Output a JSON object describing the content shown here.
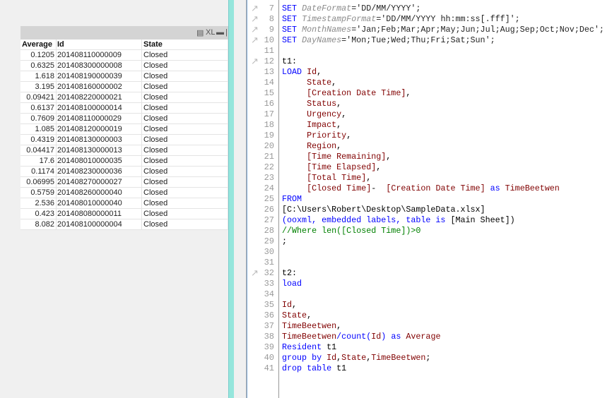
{
  "table": {
    "caption_icons": [
      "print-icon",
      "xl-export-icon",
      "minimize-icon",
      "restore-icon"
    ],
    "caption_xl": "XL",
    "columns": [
      "Average",
      "Id",
      "State"
    ],
    "rows": [
      [
        "0.1205",
        "201408110000009",
        "Closed"
      ],
      [
        "0.6325",
        "201408300000008",
        "Closed"
      ],
      [
        "1.618",
        "201408190000039",
        "Closed"
      ],
      [
        "3.195",
        "201408160000002",
        "Closed"
      ],
      [
        "0.09421",
        "201408220000021",
        "Closed"
      ],
      [
        "0.6137",
        "201408100000014",
        "Closed"
      ],
      [
        "0.7609",
        "201408110000029",
        "Closed"
      ],
      [
        "1.085",
        "201408120000019",
        "Closed"
      ],
      [
        "0.4319",
        "201408130000003",
        "Closed"
      ],
      [
        "0.04417",
        "201408130000013",
        "Closed"
      ],
      [
        "17.6",
        "201408010000035",
        "Closed"
      ],
      [
        "0.1174",
        "201408230000036",
        "Closed"
      ],
      [
        "0.06995",
        "201408270000027",
        "Closed"
      ],
      [
        "0.5759",
        "201408260000040",
        "Closed"
      ],
      [
        "2.536",
        "201408010000040",
        "Closed"
      ],
      [
        "0.423",
        "201408080000011",
        "Closed"
      ],
      [
        "8.082",
        "201408100000004",
        "Closed"
      ]
    ]
  },
  "editor": {
    "colors": {
      "keyword": "#0000ff",
      "variable": "#8a8a8a",
      "field": "#800000",
      "comment": "#008000"
    },
    "lines": [
      {
        "n": "7",
        "mark": true,
        "seg": [
          [
            "k",
            "SET "
          ],
          [
            "v",
            "DateFormat"
          ],
          [
            "s",
            "='DD/MM/YYYY';"
          ]
        ]
      },
      {
        "n": "8",
        "mark": true,
        "seg": [
          [
            "k",
            "SET "
          ],
          [
            "v",
            "TimestampFormat"
          ],
          [
            "s",
            "='DD/MM/YYYY hh:mm:ss[.fff]';"
          ]
        ]
      },
      {
        "n": "9",
        "mark": true,
        "seg": [
          [
            "k",
            "SET "
          ],
          [
            "v",
            "MonthNames"
          ],
          [
            "s",
            "='Jan;Feb;Mar;Apr;May;Jun;Jul;Aug;Sep;Oct;Nov;Dec';"
          ]
        ]
      },
      {
        "n": "10",
        "mark": true,
        "seg": [
          [
            "k",
            "SET "
          ],
          [
            "v",
            "DayNames"
          ],
          [
            "s",
            "='Mon;Tue;Wed;Thu;Fri;Sat;Sun';"
          ]
        ]
      },
      {
        "n": "11",
        "seg": []
      },
      {
        "n": "12",
        "mark": true,
        "seg": [
          [
            "p",
            "t1:"
          ]
        ]
      },
      {
        "n": "13",
        "seg": [
          [
            "k",
            "LOAD "
          ],
          [
            "f",
            "Id"
          ],
          [
            "p",
            ","
          ]
        ]
      },
      {
        "n": "14",
        "seg": [
          [
            "p",
            "     "
          ],
          [
            "f",
            "State"
          ],
          [
            "p",
            ","
          ]
        ]
      },
      {
        "n": "15",
        "seg": [
          [
            "p",
            "     "
          ],
          [
            "f",
            "[Creation Date Time]"
          ],
          [
            "p",
            ","
          ]
        ]
      },
      {
        "n": "16",
        "seg": [
          [
            "p",
            "     "
          ],
          [
            "f",
            "Status"
          ],
          [
            "p",
            ","
          ]
        ]
      },
      {
        "n": "17",
        "seg": [
          [
            "p",
            "     "
          ],
          [
            "f",
            "Urgency"
          ],
          [
            "p",
            ","
          ]
        ]
      },
      {
        "n": "18",
        "seg": [
          [
            "p",
            "     "
          ],
          [
            "f",
            "Impact"
          ],
          [
            "p",
            ","
          ]
        ]
      },
      {
        "n": "19",
        "seg": [
          [
            "p",
            "     "
          ],
          [
            "f",
            "Priority"
          ],
          [
            "p",
            ","
          ]
        ]
      },
      {
        "n": "20",
        "seg": [
          [
            "p",
            "     "
          ],
          [
            "f",
            "Region"
          ],
          [
            "p",
            ","
          ]
        ]
      },
      {
        "n": "21",
        "seg": [
          [
            "p",
            "     "
          ],
          [
            "f",
            "[Time Remaining]"
          ],
          [
            "p",
            ","
          ]
        ]
      },
      {
        "n": "22",
        "seg": [
          [
            "p",
            "     "
          ],
          [
            "f",
            "[Time Elapsed]"
          ],
          [
            "p",
            ","
          ]
        ]
      },
      {
        "n": "23",
        "seg": [
          [
            "p",
            "     "
          ],
          [
            "f",
            "[Total Time]"
          ],
          [
            "p",
            ","
          ]
        ]
      },
      {
        "n": "24",
        "seg": [
          [
            "p",
            "     "
          ],
          [
            "f",
            "[Closed Time]"
          ],
          [
            "p",
            "-  "
          ],
          [
            "f",
            "[Creation Date Time]"
          ],
          [
            "k",
            " as "
          ],
          [
            "f",
            "TimeBeetwen"
          ]
        ]
      },
      {
        "n": "25",
        "seg": [
          [
            "k",
            "FROM"
          ]
        ]
      },
      {
        "n": "26",
        "seg": [
          [
            "p",
            "[C:\\Users\\Robert\\Desktop\\SampleData.xlsx]"
          ]
        ]
      },
      {
        "n": "27",
        "seg": [
          [
            "k",
            "(ooxml, embedded labels, table is "
          ],
          [
            "p",
            "[Main Sheet])"
          ]
        ]
      },
      {
        "n": "28",
        "seg": [
          [
            "c",
            "//Where len([Closed Time])>0"
          ]
        ]
      },
      {
        "n": "29",
        "seg": [
          [
            "p",
            ";"
          ]
        ]
      },
      {
        "n": "30",
        "seg": []
      },
      {
        "n": "31",
        "seg": []
      },
      {
        "n": "32",
        "mark": true,
        "seg": [
          [
            "p",
            "t2:"
          ]
        ]
      },
      {
        "n": "33",
        "seg": [
          [
            "k",
            "load"
          ]
        ]
      },
      {
        "n": "34",
        "seg": []
      },
      {
        "n": "35",
        "seg": [
          [
            "f",
            "Id"
          ],
          [
            "p",
            ","
          ]
        ]
      },
      {
        "n": "36",
        "seg": [
          [
            "f",
            "State"
          ],
          [
            "p",
            ","
          ]
        ]
      },
      {
        "n": "37",
        "seg": [
          [
            "f",
            "TimeBeetwen"
          ],
          [
            "p",
            ","
          ]
        ]
      },
      {
        "n": "38",
        "seg": [
          [
            "f",
            "TimeBeetwen"
          ],
          [
            "k",
            "/count("
          ],
          [
            "f",
            "Id"
          ],
          [
            "k",
            ") as "
          ],
          [
            "f",
            "Average"
          ]
        ]
      },
      {
        "n": "39",
        "seg": [
          [
            "k",
            "Resident "
          ],
          [
            "p",
            "t1"
          ]
        ]
      },
      {
        "n": "40",
        "seg": [
          [
            "k",
            "group by "
          ],
          [
            "f",
            "Id"
          ],
          [
            "p",
            ","
          ],
          [
            "f",
            "State"
          ],
          [
            "p",
            ","
          ],
          [
            "f",
            "TimeBeetwen"
          ],
          [
            "p",
            ";"
          ]
        ]
      },
      {
        "n": "41",
        "seg": [
          [
            "k",
            "drop table "
          ],
          [
            "p",
            "t1"
          ]
        ]
      }
    ]
  }
}
